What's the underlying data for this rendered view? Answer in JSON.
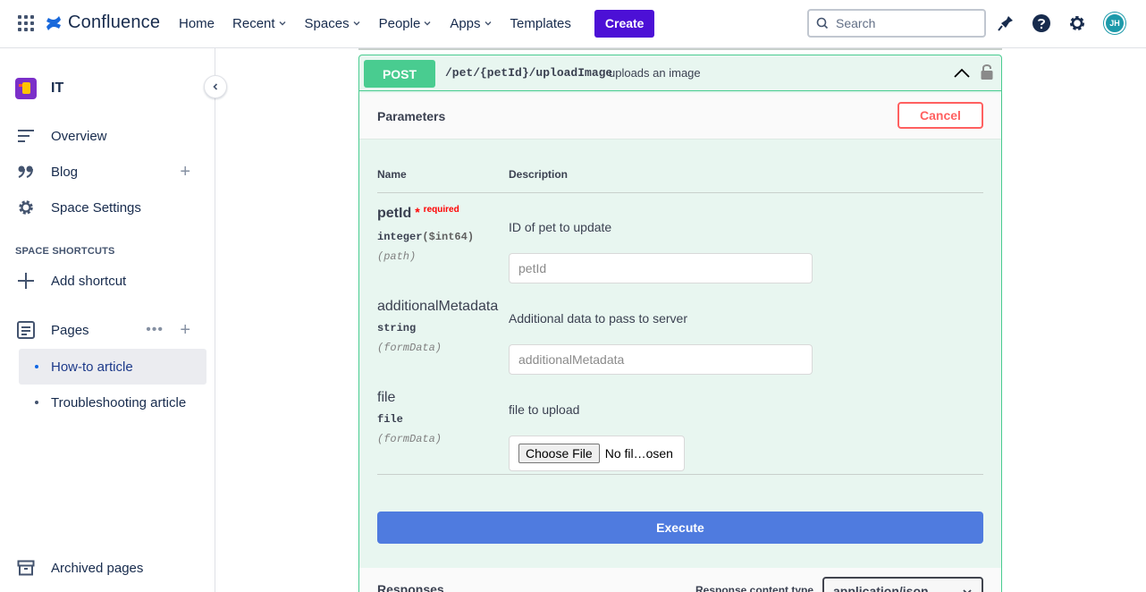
{
  "header": {
    "app_name": "Confluence",
    "nav": [
      {
        "label": "Home",
        "has_dropdown": false
      },
      {
        "label": "Recent",
        "has_dropdown": true
      },
      {
        "label": "Spaces",
        "has_dropdown": true
      },
      {
        "label": "People",
        "has_dropdown": true
      },
      {
        "label": "Apps",
        "has_dropdown": true
      },
      {
        "label": "Templates",
        "has_dropdown": false
      }
    ],
    "create_label": "Create",
    "search_placeholder": "Search",
    "avatar_initials": "JH",
    "icons": [
      "apps-grid-icon",
      "notifications-icon",
      "help-icon",
      "settings-icon"
    ]
  },
  "sidebar": {
    "space_name": "IT",
    "items": [
      {
        "label": "Overview",
        "icon": "overview-icon"
      },
      {
        "label": "Blog",
        "icon": "quote-icon"
      },
      {
        "label": "Space Settings",
        "icon": "gear-icon"
      }
    ],
    "shortcuts_heading": "SPACE SHORTCUTS",
    "add_shortcut_label": "Add shortcut",
    "pages_label": "Pages",
    "pages": [
      {
        "label": "How-to article",
        "active": true
      },
      {
        "label": "Troubleshooting article",
        "active": false
      }
    ],
    "archived_label": "Archived pages"
  },
  "operation": {
    "method": "POST",
    "path": "/pet/{petId}/uploadImage",
    "summary": "uploads an image",
    "parameters_title": "Parameters",
    "cancel_label": "Cancel",
    "columns": {
      "name": "Name",
      "description": "Description"
    },
    "params": [
      {
        "name": "petId",
        "required_mark": "*",
        "required_label": "required",
        "type": "integer",
        "format": "($int64)",
        "in": "(path)",
        "description": "ID of pet to update",
        "placeholder": "petId"
      },
      {
        "name": "additionalMetadata",
        "type": "string",
        "in": "(formData)",
        "description": "Additional data to pass to server",
        "placeholder": "additionalMetadata"
      },
      {
        "name": "file",
        "type": "file",
        "in": "(formData)",
        "description": "file to upload",
        "choose_file_label": "Choose File",
        "no_file_label": "No fil…osen"
      }
    ],
    "execute_label": "Execute",
    "responses_title": "Responses",
    "response_content_type_label": "Response content type",
    "response_content_type_value": "application/json"
  },
  "colors": {
    "post_green": "#49cc90",
    "create_purple": "#4c10d6",
    "execute_blue": "#4f7bdf",
    "cancel_red": "#ff6060"
  }
}
